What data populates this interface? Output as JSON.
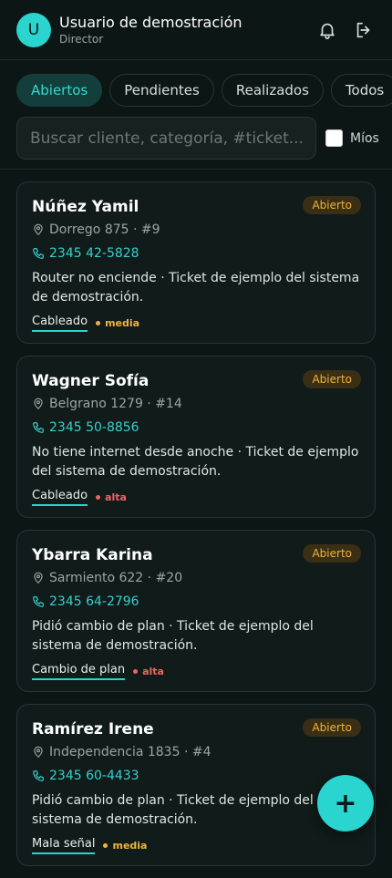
{
  "header": {
    "avatar_initial": "U",
    "user_name": "Usuario de demostración",
    "user_role": "Director",
    "icons": [
      "bell-icon",
      "logout-icon"
    ]
  },
  "tabs": [
    {
      "label": "Abiertos",
      "active": true
    },
    {
      "label": "Pendientes",
      "active": false
    },
    {
      "label": "Realizados",
      "active": false
    },
    {
      "label": "Todos",
      "active": false
    }
  ],
  "search": {
    "placeholder": "Buscar cliente, categoría, #ticket...",
    "value": "",
    "mine_label": "Míos",
    "mine_checked": false
  },
  "tickets": [
    {
      "name": "Núñez Yamil",
      "status": "Abierto",
      "address": "Dorrego 875 · #9",
      "phone": "2345 42-5828",
      "description": "Router no enciende · Ticket de ejemplo del sistema de demostración.",
      "category": "Cableado",
      "priority": "media"
    },
    {
      "name": "Wagner Sofía",
      "status": "Abierto",
      "address": "Belgrano 1279 · #14",
      "phone": "2345 50-8856",
      "description": "No tiene internet desde anoche · Ticket de ejemplo del sistema de demostración.",
      "category": "Cableado",
      "priority": "alta"
    },
    {
      "name": "Ybarra Karina",
      "status": "Abierto",
      "address": "Sarmiento 622 · #20",
      "phone": "2345 64-2796",
      "description": "Pidió cambio de plan · Ticket de ejemplo del sistema de demostración.",
      "category": "Cambio de plan",
      "priority": "alta"
    },
    {
      "name": "Ramírez Irene",
      "status": "Abierto",
      "address": "Independencia 1835 · #4",
      "phone": "2345 60-4433",
      "description": "Pidió cambio de plan · Ticket de ejemplo del sistema de demostración.",
      "category": "Mala señal",
      "priority": "media"
    }
  ],
  "fab_label": "+",
  "colors": {
    "accent": "#2ad4cf",
    "background": "#0c1614",
    "badge_text": "#f0b43a",
    "priority_media": "#f0b43a",
    "priority_alta": "#f06464"
  }
}
